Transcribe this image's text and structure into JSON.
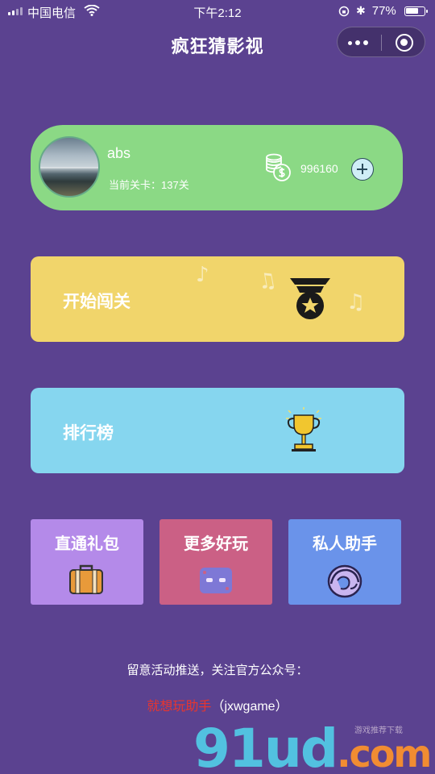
{
  "status_bar": {
    "carrier": "中国电信",
    "time": "下午2:12",
    "battery": "77%",
    "battery_level": 0.77
  },
  "nav": {
    "title": "疯狂猜影视"
  },
  "user": {
    "name": "abs",
    "level_text": "当前关卡：137关",
    "coins": "996160"
  },
  "buttons": {
    "start": "开始闯关",
    "ranking": "排行榜"
  },
  "cards": [
    {
      "label": "直通礼包",
      "icon": "suitcase-icon",
      "color": "#b48ae9"
    },
    {
      "label": "更多好玩",
      "icon": "game-controller-icon",
      "color": "#cb6085"
    },
    {
      "label": "私人助手",
      "icon": "helper-avatar-icon",
      "color": "#6a93ea"
    }
  ],
  "footer": {
    "note": "留意活动推送，关注官方公众号：",
    "account_name": "就想玩助手",
    "account_id": "（jxwgame）"
  },
  "watermark": {
    "text": "91ud",
    "domain": ".com",
    "small": "游戏推荐下载"
  },
  "colors": {
    "background": "#5b4290",
    "user_card": "#8bd985",
    "start_button": "#f1d56b",
    "ranking_button": "#86d6ef",
    "account_name": "#e8352f"
  }
}
